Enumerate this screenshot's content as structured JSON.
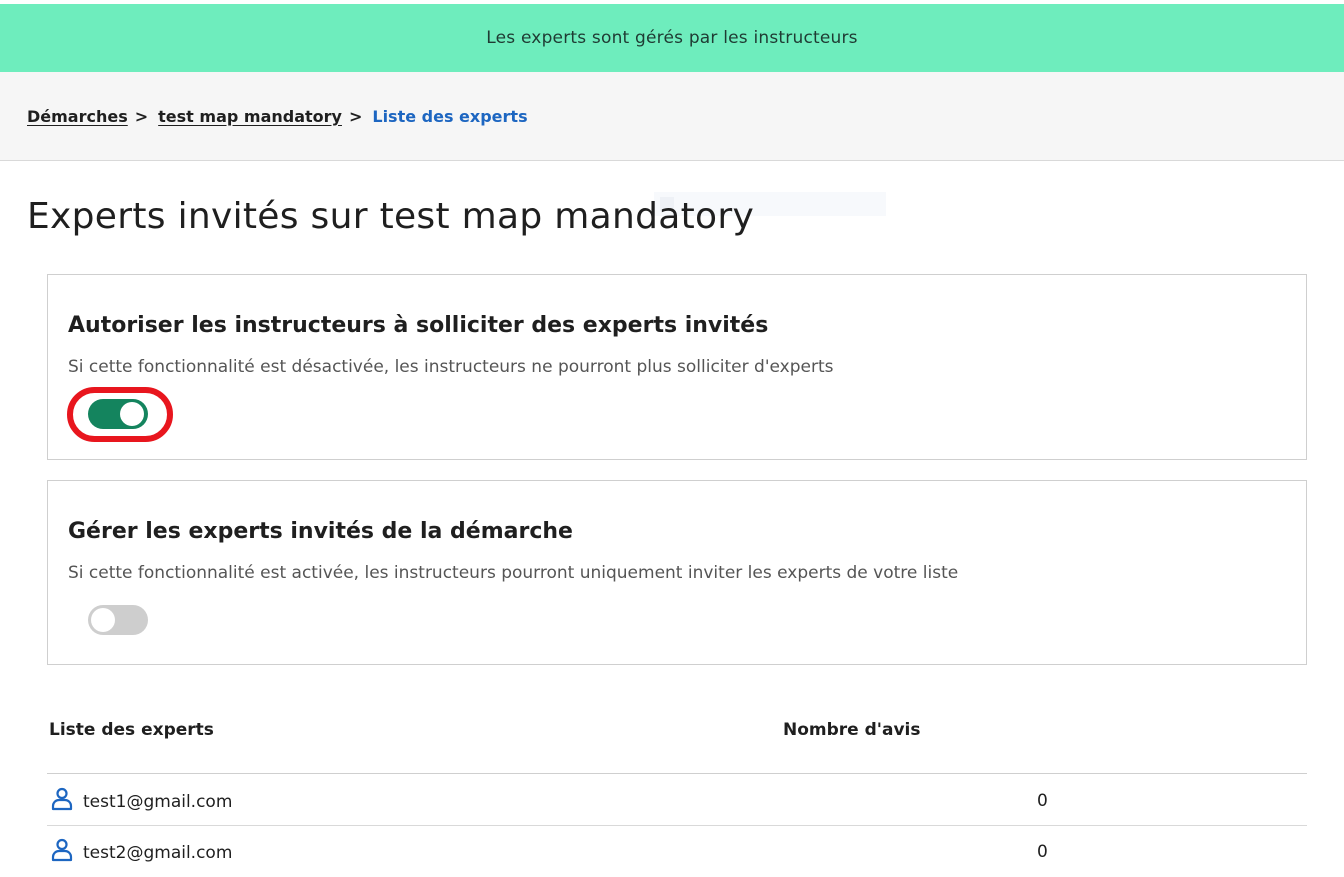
{
  "banner": {
    "message": "Les experts sont gérés par les instructeurs",
    "color": "#6eedbd"
  },
  "breadcrumb": {
    "items": [
      "Démarches",
      "test map mandatory"
    ],
    "separator": ">",
    "current": "Liste des experts"
  },
  "page": {
    "title": "Experts invités sur test map mandatory"
  },
  "settings": [
    {
      "title": "Autoriser les instructeurs à solliciter des experts invités",
      "description": "Si cette fonctionnalité est désactivée, les instructeurs ne pourront plus solliciter d'experts",
      "enabled": true,
      "highlighted": true
    },
    {
      "title": "Gérer les experts invités de la démarche",
      "description": "Si cette fonctionnalité est activée, les instructeurs pourront uniquement inviter les experts de votre liste",
      "enabled": false,
      "highlighted": false
    }
  ],
  "experts_table": {
    "columns": [
      "Liste des experts",
      "Nombre d'avis"
    ],
    "rows": [
      {
        "email": "test1@gmail.com",
        "count": "0",
        "icon": "user-icon"
      },
      {
        "email": "test2@gmail.com",
        "count": "0",
        "icon": "user-icon"
      }
    ]
  },
  "colors": {
    "toggle_on": "#14845e",
    "toggle_off": "#cecece",
    "link_current": "#1d66c1",
    "highlight_ring": "#e8161e"
  }
}
